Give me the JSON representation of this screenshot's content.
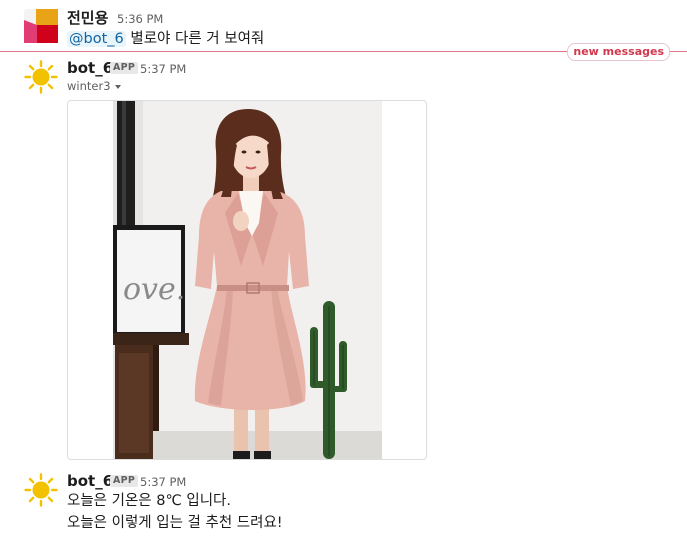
{
  "messages": [
    {
      "author": "전민용",
      "time": "5:36 PM",
      "mention": "@bot_6",
      "text": "별로야 다른 거 보여줘"
    },
    {
      "author": "bot_6",
      "badge": "APP",
      "time": "5:37 PM",
      "attachment_label": "winter3",
      "photo_sign_text": "ove."
    },
    {
      "author": "bot_6",
      "badge": "APP",
      "time": "5:37 PM",
      "lines": [
        "오늘은 기온은 8℃ 입니다.",
        "오늘은 이렇게 입는 걸 추천 드려요!"
      ]
    }
  ],
  "divider": {
    "label": "new messages",
    "color": "#e0768a"
  },
  "colors": {
    "mention": "#1264a3",
    "sun": "#f2c200",
    "avatar_orange": "#e8a317",
    "avatar_red": "#d0021b",
    "avatar_pink": "#e13d74"
  },
  "icons": {
    "user_avatar": "geometric-avatar-icon",
    "bot_avatar": "sun-icon"
  }
}
